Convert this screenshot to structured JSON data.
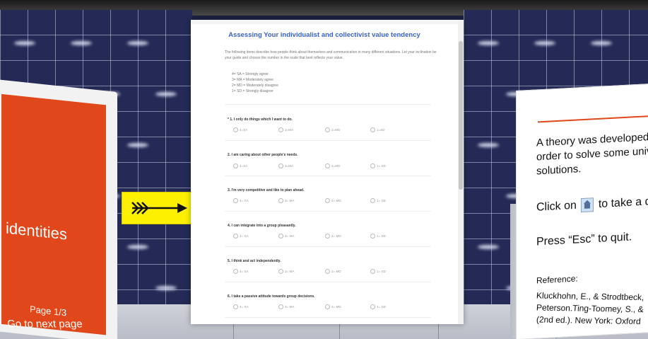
{
  "survey": {
    "title": "Assessing Your individualist and collectivist value tendency",
    "intro": "The following items describe how people think about themselves and communication in many different situations. Let your inclination be your guide and choose the number in the scale that best reflects your value.",
    "scale": [
      "4= SA = Strongly agree",
      "3= MA = Moderately agree",
      "2= MD = Moderately disagree",
      "1= SD = Strongly disagree"
    ],
    "questions": [
      {
        "text": "* 1. I only do things which I want to do.",
        "options": [
          "4=SA",
          "3=MA",
          "2=MD",
          "1=SD"
        ]
      },
      {
        "text": "2. I am caring about other people's needs.",
        "options": [
          "4=SA",
          "3=MA",
          "2=MD",
          "1= SD"
        ]
      },
      {
        "text": "3. I'm very competitive and like to plan ahead.",
        "options": [
          "4= SA",
          "3= MA",
          "2= MD",
          "1= SD"
        ]
      },
      {
        "text": "4. I can integrate into a group pleasantly.",
        "options": [
          "4= SA",
          "3= MA",
          "2= MD",
          "1= SD"
        ]
      },
      {
        "text": "5. I think and act independently.",
        "options": [
          "4= SA",
          "3= MA",
          "2= MD",
          "1= SD"
        ]
      },
      {
        "text": "6. I take a passive attitude towards group decisions.",
        "options": [
          "4= SA",
          "3= MA",
          "2= MD",
          "1= SD"
        ]
      }
    ]
  },
  "left_slide": {
    "title": "identities",
    "page": "Page 1/3",
    "next": "Go to next page"
  },
  "right_slide": {
    "line1": "A theory was developed",
    "line2": "order to solve some univ",
    "line3": "solutions.",
    "click_before": "Click on",
    "click_after": "to take a q",
    "esc": "Press “Esc” to quit.",
    "ref_label": "Reference:",
    "ref1": "Kluckhohn, E., & Strodtbeck,",
    "ref2": "Peterson.Ting-Toomey, S., &",
    "ref3": "(2nd ed.). New York: Oxford"
  },
  "colors": {
    "accent_title": "#3b63c4",
    "slide_orange": "#e0481b",
    "sign_yellow": "#fef100"
  },
  "icons": {
    "next_arrow": "arrow-right-icon",
    "home": "home-icon"
  }
}
